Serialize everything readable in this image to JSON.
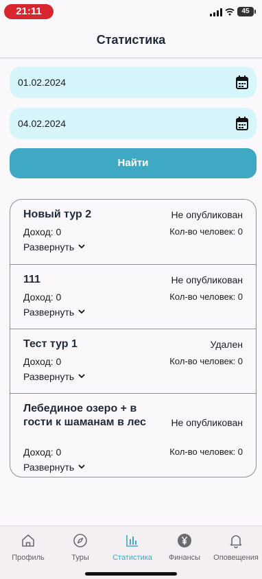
{
  "status_bar": {
    "time": "21:11",
    "battery": "45"
  },
  "header": {
    "title": "Статистика"
  },
  "filters": {
    "date_from": "01.02.2024",
    "date_to": "04.02.2024",
    "find_label": "Найти"
  },
  "tours": [
    {
      "title": "Новый тур 2",
      "status": "Не опубликован",
      "income": "Доход: 0",
      "people": "Кол-во человек: 0",
      "expand": "Развернуть"
    },
    {
      "title": "111",
      "status": "Не опубликован",
      "income": "Доход: 0",
      "people": "Кол-во человек: 0",
      "expand": "Развернуть"
    },
    {
      "title": "Тест тур 1",
      "status": "Удален",
      "income": "Доход: 0",
      "people": "Кол-во человек: 0",
      "expand": "Развернуть"
    },
    {
      "title": "Лебединое озеро + в гости к шаманам в лес",
      "status": "Не опубликован",
      "income": "Доход: 0",
      "people": "Кол-во человек: 0",
      "expand": "Развернуть"
    }
  ],
  "tabs": [
    {
      "label": "Профиль",
      "icon": "home-icon"
    },
    {
      "label": "Туры",
      "icon": "compass-icon"
    },
    {
      "label": "Статистика",
      "icon": "bar-chart-icon",
      "active": true
    },
    {
      "label": "Финансы",
      "icon": "yen-coin-icon"
    },
    {
      "label": "Оповещения",
      "icon": "bell-icon"
    }
  ],
  "colors": {
    "accent": "#3fa9c4",
    "field_bg": "#d7f6fc",
    "time_pill": "#d7262e"
  }
}
